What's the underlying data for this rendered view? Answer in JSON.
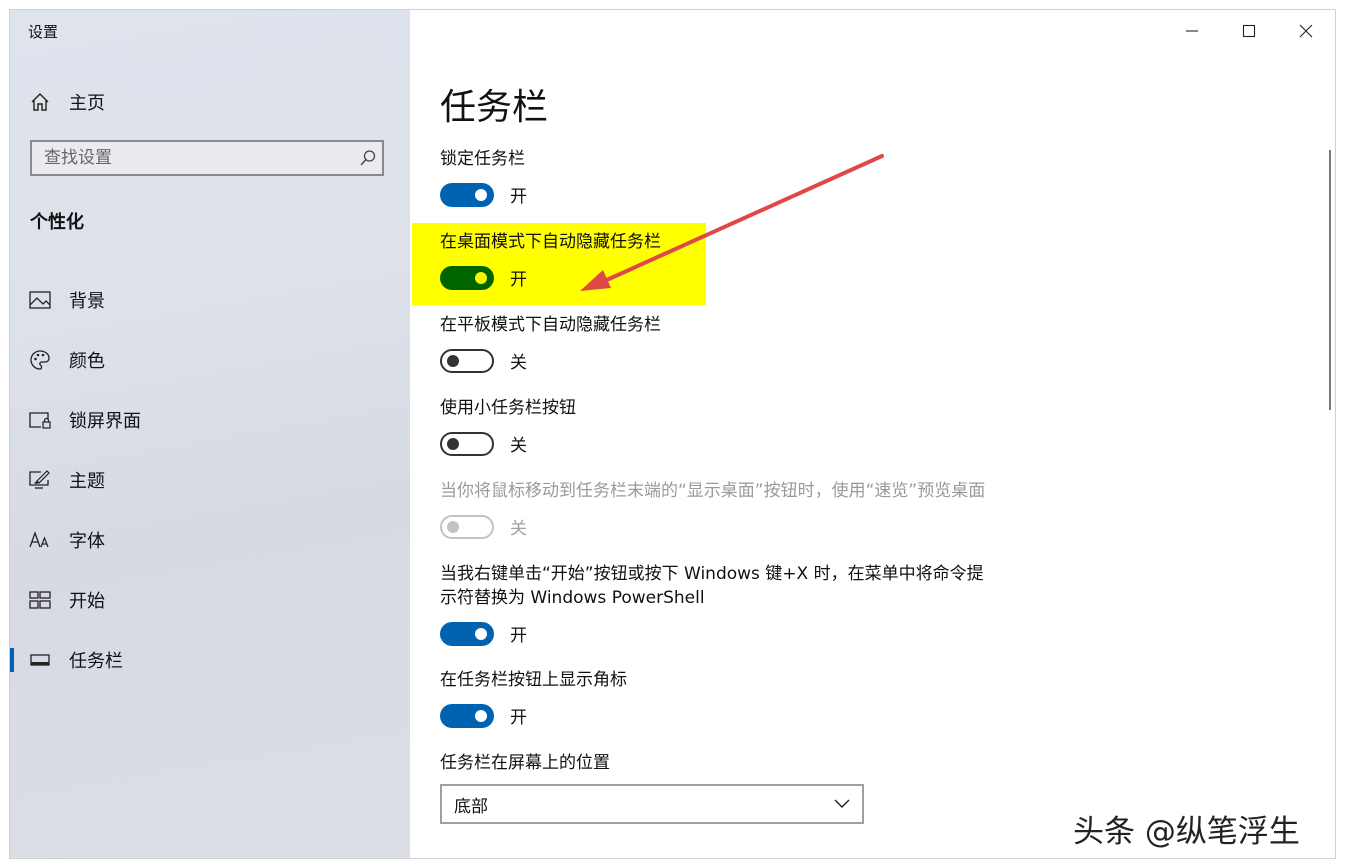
{
  "window": {
    "title": "设置"
  },
  "sidebar": {
    "home_label": "主页",
    "search_placeholder": "查找设置",
    "section_title": "个性化",
    "items": [
      {
        "label": "背景",
        "icon": "picture-icon"
      },
      {
        "label": "颜色",
        "icon": "palette-icon"
      },
      {
        "label": "锁屏界面",
        "icon": "lock-screen-icon"
      },
      {
        "label": "主题",
        "icon": "theme-icon"
      },
      {
        "label": "字体",
        "icon": "font-icon"
      },
      {
        "label": "开始",
        "icon": "start-icon"
      },
      {
        "label": "任务栏",
        "icon": "taskbar-icon",
        "active": true
      }
    ]
  },
  "main": {
    "title": "任务栏",
    "settings": [
      {
        "label": "锁定任务栏",
        "state": "开",
        "on": true
      },
      {
        "label": "在桌面模式下自动隐藏任务栏",
        "state": "开",
        "on": true,
        "highlighted": true
      },
      {
        "label": "在平板模式下自动隐藏任务栏",
        "state": "关",
        "on": false
      },
      {
        "label": "使用小任务栏按钮",
        "state": "关",
        "on": false
      },
      {
        "label": "当你将鼠标移动到任务栏末端的“显示桌面”按钮时，使用“速览”预览桌面",
        "state": "关",
        "on": false,
        "disabled": true
      },
      {
        "label_line1": "当我右键单击“开始”按钮或按下 Windows 键+X 时，在菜单中将命令提",
        "label_line2": "示符替换为 Windows PowerShell",
        "state": "开",
        "on": true
      },
      {
        "label": "在任务栏按钮上显示角标",
        "state": "开",
        "on": true
      }
    ],
    "position_label": "任务栏在屏幕上的位置",
    "position_value": "底部"
  },
  "watermark": "头条 @纵笔浮生",
  "colors": {
    "accent": "#0063b1",
    "highlight": "#ffff00",
    "highlighted_toggle": "#006400",
    "annotation_arrow": "#e04848"
  }
}
